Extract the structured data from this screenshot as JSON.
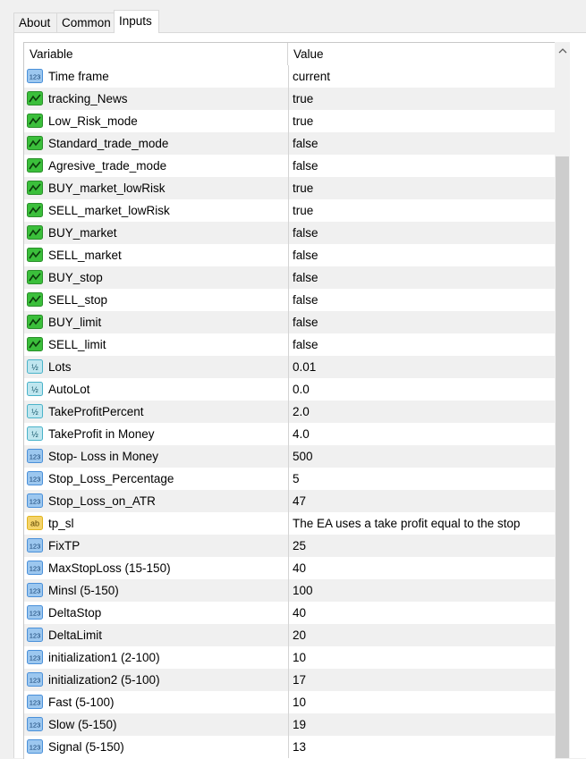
{
  "tabs": [
    "About",
    "Common",
    "Inputs"
  ],
  "active_tab": "Inputs",
  "table": {
    "headers": [
      "Variable",
      "Value"
    ],
    "rows": [
      {
        "icon": "int-icon",
        "name": "Time frame",
        "value": "current"
      },
      {
        "icon": "bool-icon",
        "name": "tracking_News",
        "value": "true"
      },
      {
        "icon": "bool-icon",
        "name": "Low_Risk_mode",
        "value": "true"
      },
      {
        "icon": "bool-icon",
        "name": "Standard_trade_mode",
        "value": "false"
      },
      {
        "icon": "bool-icon",
        "name": "Agresive_trade_mode",
        "value": "false"
      },
      {
        "icon": "bool-icon",
        "name": "BUY_market_lowRisk",
        "value": "true"
      },
      {
        "icon": "bool-icon",
        "name": "SELL_market_lowRisk",
        "value": "true"
      },
      {
        "icon": "bool-icon",
        "name": "BUY_market",
        "value": "false"
      },
      {
        "icon": "bool-icon",
        "name": "SELL_market",
        "value": "false"
      },
      {
        "icon": "bool-icon",
        "name": "BUY_stop",
        "value": "false"
      },
      {
        "icon": "bool-icon",
        "name": "SELL_stop",
        "value": "false"
      },
      {
        "icon": "bool-icon",
        "name": "BUY_limit",
        "value": "false"
      },
      {
        "icon": "bool-icon",
        "name": "SELL_limit",
        "value": "false"
      },
      {
        "icon": "double-icon",
        "name": "Lots",
        "value": "0.01"
      },
      {
        "icon": "double-icon",
        "name": "AutoLot",
        "value": "0.0"
      },
      {
        "icon": "double-icon",
        "name": "TakeProfitPercent",
        "value": "2.0"
      },
      {
        "icon": "double-icon",
        "name": "TakeProfit in Money",
        "value": "4.0"
      },
      {
        "icon": "int-icon",
        "name": "Stop- Loss in Money",
        "value": "500"
      },
      {
        "icon": "int-icon",
        "name": "Stop_Loss_Percentage",
        "value": "5"
      },
      {
        "icon": "int-icon",
        "name": "Stop_Loss_on_ATR",
        "value": "47"
      },
      {
        "icon": "string-icon",
        "name": "tp_sl",
        "value": "The EA uses a take profit equal to the stop"
      },
      {
        "icon": "int-icon",
        "name": "FixTP",
        "value": "25"
      },
      {
        "icon": "int-icon",
        "name": "MaxStopLoss (15-150)",
        "value": "40"
      },
      {
        "icon": "int-icon",
        "name": "Minsl (5-150)",
        "value": "100"
      },
      {
        "icon": "int-icon",
        "name": "DeltaStop",
        "value": "40"
      },
      {
        "icon": "int-icon",
        "name": "DeltaLimit",
        "value": "20"
      },
      {
        "icon": "int-icon",
        "name": "initialization1 (2-100)",
        "value": "10"
      },
      {
        "icon": "int-icon",
        "name": "initialization2 (5-100)",
        "value": "17"
      },
      {
        "icon": "int-icon",
        "name": "Fast (5-100)",
        "value": "10"
      },
      {
        "icon": "int-icon",
        "name": "Slow (5-150)",
        "value": "19"
      },
      {
        "icon": "int-icon",
        "name": "Signal (5-150)",
        "value": "13"
      }
    ]
  },
  "scrollbar": {
    "up_glyph": "^",
    "position_fraction": 0.0
  },
  "colors": {
    "row_alt": "#f0f0f0",
    "bool_icon": "#3bbf3b",
    "int_icon": "#4a90d9",
    "double_icon": "#4ab3c9",
    "string_icon": "#e0b520"
  }
}
